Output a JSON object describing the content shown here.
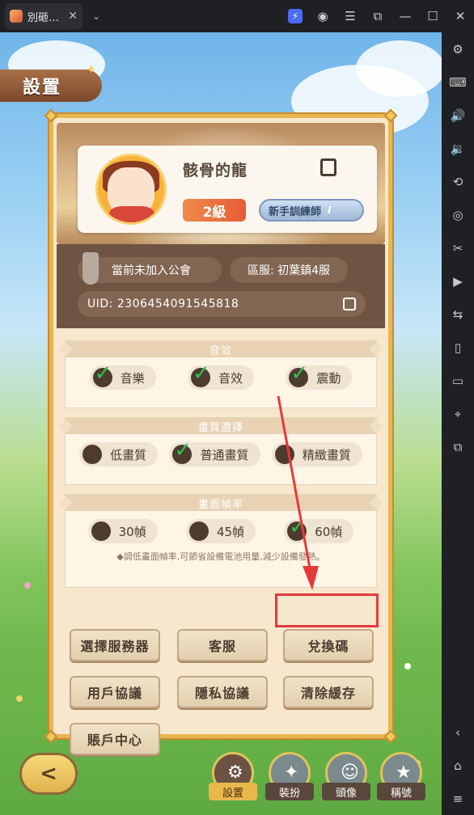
{
  "window": {
    "tab_title": "別砸…",
    "close": "✕",
    "dropdown": "⌄"
  },
  "titlebar_icons": [
    "bolt-icon",
    "account-icon",
    "menu-icon",
    "screen-icon",
    "minimize-icon",
    "maximize-icon",
    "close-icon"
  ],
  "sidebar_icons": [
    "settings-icon",
    "keyboard-icon",
    "volume-up-icon",
    "volume-down-icon",
    "rotate-icon",
    "fps-icon",
    "scissors-icon",
    "record-icon",
    "share-icon",
    "shake-icon",
    "folder-icon",
    "location-icon",
    "multi-instance-icon",
    "back-icon",
    "home-icon",
    "recent-icon"
  ],
  "game": {
    "screen_title": "設置",
    "profile": {
      "username": "骸骨的龍",
      "level": "2級",
      "rank": "新手訓練師",
      "rank_tier": "I"
    },
    "info": {
      "guild": "當前未加入公會",
      "server": "區服: 初葉鎮4服",
      "uid": "UID: 230645409154581​8"
    },
    "sections": {
      "sound": {
        "title": "音效",
        "options": [
          {
            "label": "音樂",
            "checked": true
          },
          {
            "label": "音效",
            "checked": true
          },
          {
            "label": "震動",
            "checked": true
          }
        ]
      },
      "quality": {
        "title": "畫質選擇",
        "options": [
          {
            "label": "低畫質",
            "checked": false
          },
          {
            "label": "普通畫質",
            "checked": true
          },
          {
            "label": "精緻畫質",
            "checked": false
          }
        ]
      },
      "framerate": {
        "title": "畫面幀率",
        "options": [
          {
            "label": "30幀",
            "checked": false
          },
          {
            "label": "45幀",
            "checked": false
          },
          {
            "label": "60幀",
            "checked": true
          }
        ],
        "tip": "◆調低畫面幀率,可節省設備電池用量,減少設備發熱。"
      }
    },
    "buttons": {
      "select_server": "選擇服務器",
      "support": "客服",
      "redeem": "兌換碼",
      "user_agreement": "用戶協議",
      "privacy": "隱私協議",
      "clear_cache": "清除緩存",
      "account_center": "賬戶中心"
    },
    "back": "<",
    "bottom_nav": [
      {
        "label": "設置",
        "active": true
      },
      {
        "label": "裝扮",
        "active": false
      },
      {
        "label": "頭像",
        "active": false
      },
      {
        "label": "稱號",
        "active": false
      }
    ]
  }
}
